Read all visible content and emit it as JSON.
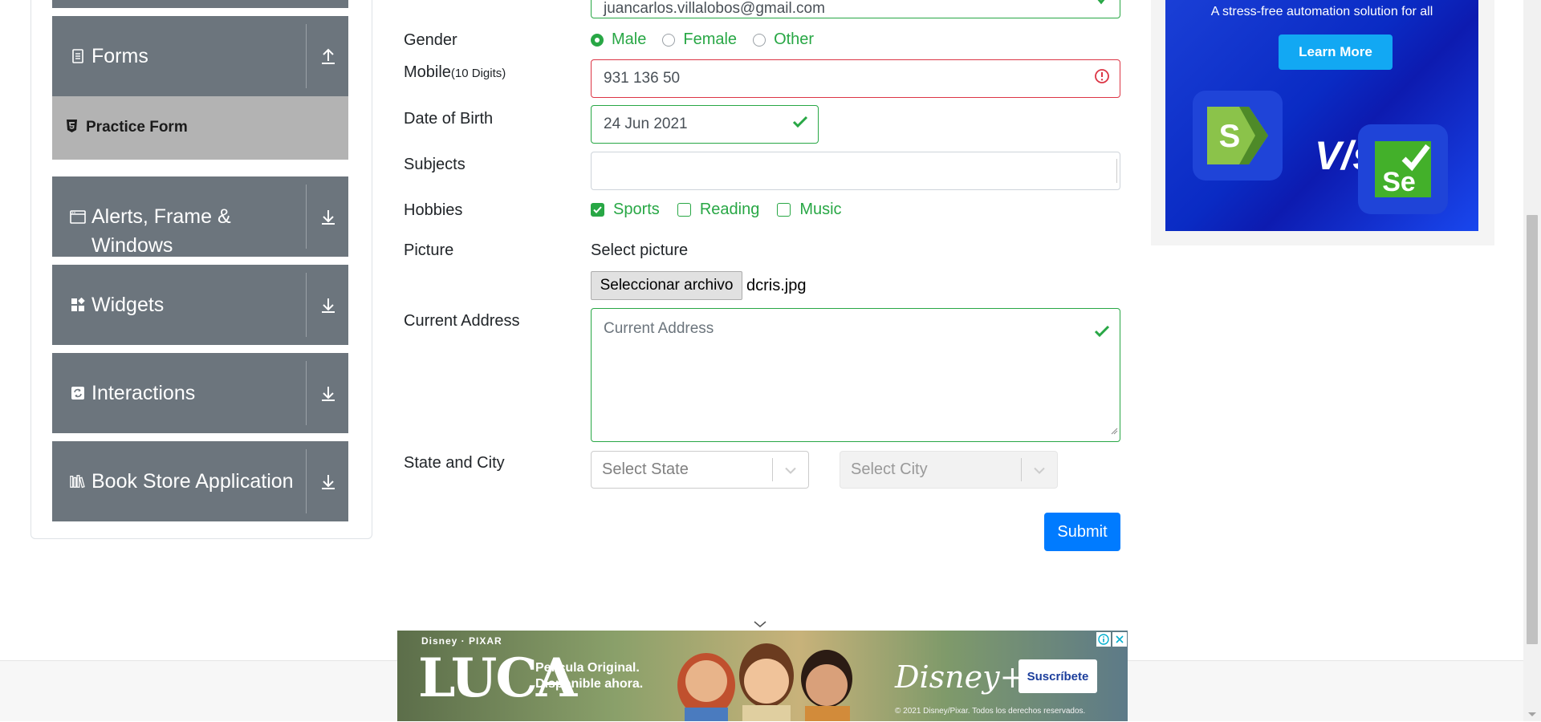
{
  "sidebar": {
    "groups": [
      {
        "label": "Forms",
        "icon": "form-document-icon",
        "arrow": "arrow-up-icon"
      },
      {
        "label": "Alerts, Frame & Windows",
        "icon": "window-icon",
        "arrow": "arrow-down-icon"
      },
      {
        "label": "Widgets",
        "icon": "widgets-icon",
        "arrow": "arrow-down-icon"
      },
      {
        "label": "Interactions",
        "icon": "interactions-icon",
        "arrow": "arrow-down-icon"
      },
      {
        "label": "Book Store Application",
        "icon": "books-icon",
        "arrow": "arrow-down-icon"
      }
    ],
    "active_item": {
      "label": "Practice Form",
      "icon": "html5-icon"
    }
  },
  "form": {
    "email": {
      "value": "juancarlos.villalobos@gmail.com",
      "status": "valid"
    },
    "gender": {
      "label": "Gender",
      "options": [
        "Male",
        "Female",
        "Other"
      ],
      "selected": "Male"
    },
    "mobile": {
      "label": "Mobile",
      "hint": "(10 Digits)",
      "value": "931 136 50",
      "status": "invalid"
    },
    "dob": {
      "label": "Date of Birth",
      "value": "24 Jun 2021",
      "status": "valid"
    },
    "subjects": {
      "label": "Subjects",
      "value": ""
    },
    "hobbies": {
      "label": "Hobbies",
      "options": [
        {
          "label": "Sports",
          "checked": true
        },
        {
          "label": "Reading",
          "checked": false
        },
        {
          "label": "Music",
          "checked": false
        }
      ]
    },
    "picture": {
      "label": "Picture",
      "caption": "Select picture",
      "button": "Seleccionar archivo",
      "file": "dcris.jpg"
    },
    "address": {
      "label": "Current Address",
      "placeholder": "Current Address",
      "status": "valid"
    },
    "state_city": {
      "label": "State and City",
      "state_placeholder": "Select State",
      "city_placeholder": "Select City"
    },
    "submit": "Submit"
  },
  "ad_right": {
    "tagline": "A stress-free automation solution for all",
    "button": "Learn More",
    "vs_text": "V/s",
    "logo_left": "S",
    "logo_right": "Se"
  },
  "ad_bottom": {
    "brand": "Disney · PIXAR",
    "title": "LUCA",
    "line1": "Película Original.",
    "line2": "Disponible ahora.",
    "service": "Disney+",
    "button": "Suscríbete",
    "legal": "© 2021 Disney/Pixar. Todos los derechos reservados."
  },
  "colors": {
    "sidebar_bg": "#6c757d",
    "active_bg": "#b3b3b3",
    "valid": "#28a745",
    "invalid": "#dc3545",
    "primary": "#007bff"
  }
}
